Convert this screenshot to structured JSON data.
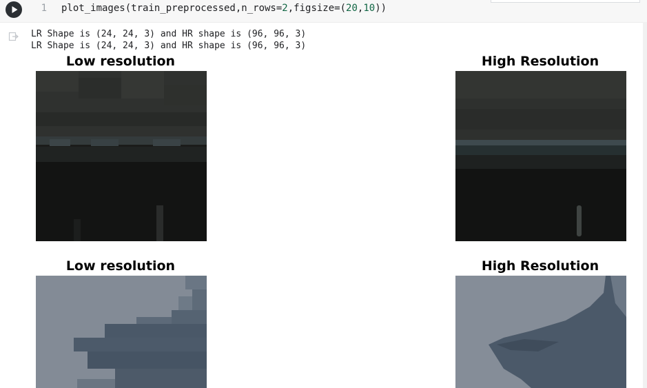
{
  "cell": {
    "line_number": "1",
    "code_prefix": "plot_images(train_preprocessed,n_rows=",
    "code_num1": "2",
    "code_mid": ",figsize=(",
    "code_num2": "20",
    "code_comma": ",",
    "code_num3": "10",
    "code_suffix": "))",
    "run_icon": "play-icon"
  },
  "output": {
    "icon": "output-redirect-icon",
    "lines": [
      "LR Shape is (24, 24, 3) and HR shape is (96, 96, 3)",
      "LR Shape is (24, 24, 3) and HR shape is (96, 96, 3)"
    ]
  },
  "figure": {
    "rows": [
      {
        "left_title": "Low resolution",
        "right_title": "High Resolution"
      },
      {
        "left_title": "Low resolution",
        "right_title": "High Resolution"
      }
    ]
  },
  "colors": {
    "code_bg": "#f7f7f7",
    "number": "#116644",
    "run_button": "#2b2f33"
  }
}
